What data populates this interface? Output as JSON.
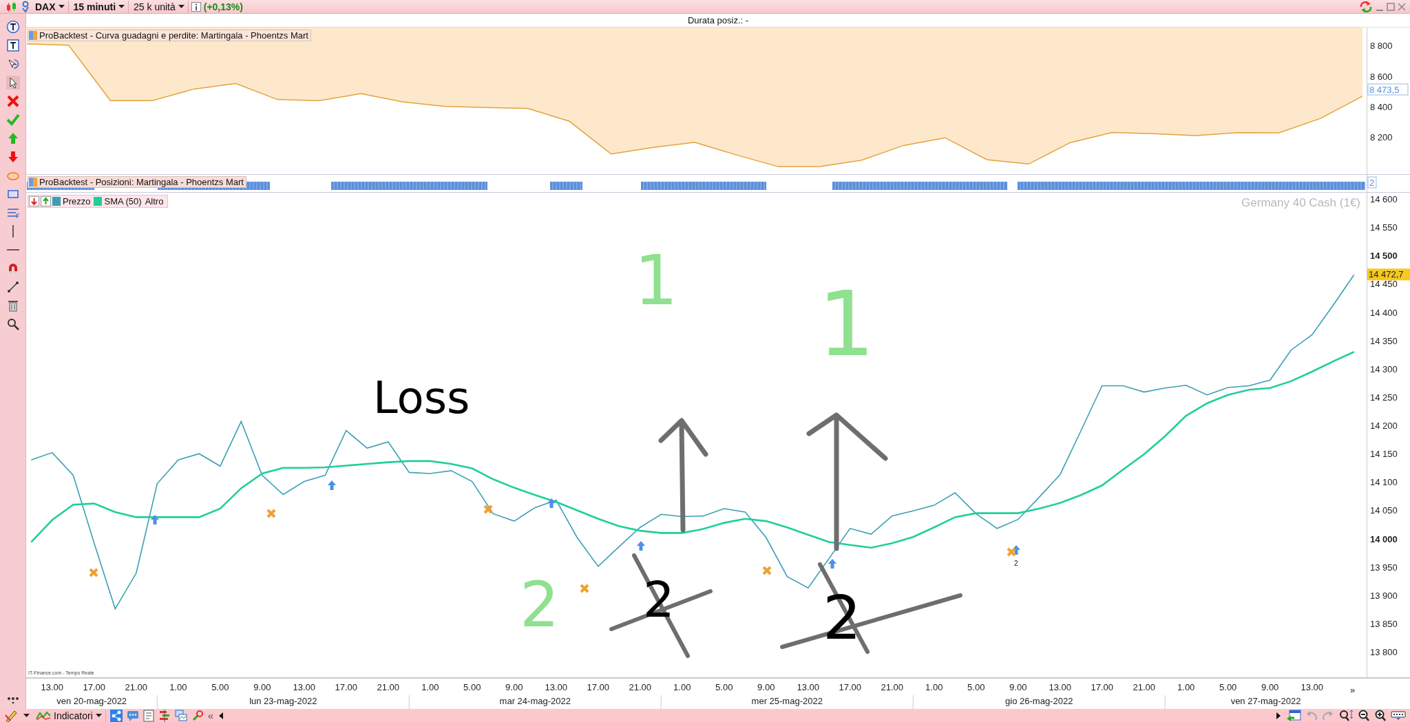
{
  "toolbar": {
    "instrument": "DAX",
    "timeframe": "15 minuti",
    "units": "25 k unità",
    "change": "(+0,13%)"
  },
  "header": {
    "text": "Durata posiz.: -"
  },
  "equity_panel": {
    "chart_data": {
      "type": "line",
      "title": "ProBacktest - Curva guadagni e perdite: Martingala - Phoentzs Mart",
      "ylim": [
        7950,
        8920
      ],
      "yticks": [
        {
          "value": 8800,
          "label": "8 800"
        },
        {
          "value": 8600,
          "label": "8 600"
        },
        {
          "value": 8400,
          "label": "8 400"
        },
        {
          "value": 8200,
          "label": "8 200"
        }
      ],
      "categories": [
        null,
        null,
        null,
        null,
        null,
        null,
        null,
        null,
        null,
        null,
        null,
        null,
        null,
        null,
        null,
        null,
        null,
        null,
        null,
        null,
        null,
        null,
        null,
        null,
        null,
        null,
        null,
        null,
        null,
        null,
        null,
        null,
        null
      ],
      "series": [
        {
          "color": "#e2a33c",
          "values": [
            8812,
            8803,
            8438,
            8438,
            8515,
            8552,
            8446,
            8438,
            8485,
            8430,
            8401,
            8393,
            8387,
            8302,
            8087,
            8130,
            8164,
            8081,
            8004,
            8004,
            8046,
            8143,
            8194,
            8050,
            8021,
            8162,
            8229,
            8221,
            8209,
            8228,
            8227,
            8322,
            8467
          ]
        }
      ]
    },
    "current_label": "8 473,5"
  },
  "positions_panel": {
    "title": "ProBacktest - Posizioni: Martingala - Phoentzs Mart",
    "axis_label": "2"
  },
  "price_panel": {
    "instrument_name": "Germany 40 Cash (1€)",
    "legend_extra": "Altro",
    "source": "IT-Finance.com - Tempo Reale",
    "current_label": "14 472,7",
    "marker_label": "2",
    "chart_data": {
      "type": "line",
      "ylim": [
        13754,
        14611
      ],
      "legend": "upper left",
      "categories": [
        null,
        "13.00",
        null,
        "17.00",
        null,
        "21.00",
        null,
        "1.00",
        null,
        "5.00",
        null,
        "9.00",
        null,
        "13.00",
        null,
        "17.00",
        null,
        "21.00",
        null,
        "1.00",
        null,
        "5.00",
        null,
        "9.00",
        null,
        "13.00",
        null,
        "17.00",
        null,
        "21.00",
        null,
        "1.00",
        null,
        "5.00",
        null,
        "9.00",
        null,
        "13.00",
        null,
        "17.00",
        null,
        "21.00",
        null,
        "1.00",
        null,
        "5.00",
        null,
        "9.00",
        null,
        "13.00",
        null,
        "17.00",
        null,
        "21.00",
        null,
        "1.00",
        null,
        "5.00",
        null,
        "9.00",
        null,
        "13.00",
        null,
        null
      ],
      "yticks": [
        {
          "value": 14600,
          "label": "14 600"
        },
        {
          "value": 14550,
          "label": "14 550"
        },
        {
          "value": 14500,
          "label": "14 500"
        },
        {
          "value": 14450,
          "label": "14 450"
        },
        {
          "value": 14400,
          "label": "14 400"
        },
        {
          "value": 14350,
          "label": "14 350"
        },
        {
          "value": 14300,
          "label": "14 300"
        },
        {
          "value": 14250,
          "label": "14 250"
        },
        {
          "value": 14200,
          "label": "14 200"
        },
        {
          "value": 14150,
          "label": "14 150"
        },
        {
          "value": 14100,
          "label": "14 100"
        },
        {
          "value": 14050,
          "label": "14 050"
        },
        {
          "value": 14000,
          "label": "14 000"
        },
        {
          "value": 13950,
          "label": "13 950"
        },
        {
          "value": 13900,
          "label": "13 900"
        },
        {
          "value": 13850,
          "label": "13 850"
        },
        {
          "value": 13800,
          "label": "13 800"
        }
      ],
      "series": [
        {
          "name": "Prezzo",
          "color": "#3a9fb5",
          "values": [
            14139,
            14152,
            14112,
            13992,
            13876,
            13939,
            14097,
            14139,
            14150,
            14128,
            14207,
            14112,
            14078,
            14101,
            14112,
            14191,
            14160,
            14171,
            14117,
            14115,
            14120,
            14101,
            14044,
            14031,
            14055,
            14068,
            14002,
            13951,
            13986,
            14020,
            14043,
            14039,
            14040,
            14053,
            14047,
            14002,
            13933,
            13913,
            13965,
            14018,
            14008,
            14040,
            14049,
            14059,
            14081,
            14044,
            14018,
            14034,
            14073,
            14113,
            14191,
            14270,
            14270,
            14259,
            14266,
            14271,
            14254,
            14267,
            14270,
            14280,
            14333,
            14360,
            14412,
            14466
          ]
        },
        {
          "name": "SMA (50)",
          "color": "#1fcf9a",
          "values": [
            13994,
            14033,
            14060,
            14062,
            14047,
            14038,
            14038,
            14038,
            14038,
            14053,
            14089,
            14115,
            14125,
            14125,
            14126,
            14129,
            14132,
            14135,
            14137,
            14137,
            14132,
            14124,
            14105,
            14090,
            14077,
            14065,
            14050,
            14035,
            14022,
            14014,
            14010,
            14010,
            14017,
            14028,
            14035,
            14031,
            14020,
            14007,
            13994,
            13989,
            13984,
            13992,
            14003,
            14020,
            14038,
            14045,
            14045,
            14045,
            14053,
            14063,
            14077,
            14094,
            14122,
            14149,
            14181,
            14217,
            14239,
            14254,
            14263,
            14266,
            14278,
            14295,
            14313,
            14330
          ]
        }
      ]
    },
    "annotations": [
      {
        "text": "Loss",
        "color": "#000000"
      },
      {
        "text": "1",
        "color": "#8fe08f"
      },
      {
        "text": "1",
        "color": "#8fe08f"
      },
      {
        "text": "2",
        "color": "#8fe08f"
      },
      {
        "text": "2",
        "color": "#000000"
      },
      {
        "text": "2",
        "color": "#000000"
      }
    ]
  },
  "time_axis": {
    "days": [
      {
        "label": "ven 20-mag-2022"
      },
      {
        "label": "lun 23-mag-2022"
      },
      {
        "label": "mar 24-mag-2022"
      },
      {
        "label": "mer 25-mag-2022"
      },
      {
        "label": "gio 26-mag-2022"
      },
      {
        "label": "ven 27-mag-2022"
      }
    ],
    "more": "»"
  },
  "bottom_bar": {
    "indicators": "Indicatori",
    "collapse": "«"
  }
}
